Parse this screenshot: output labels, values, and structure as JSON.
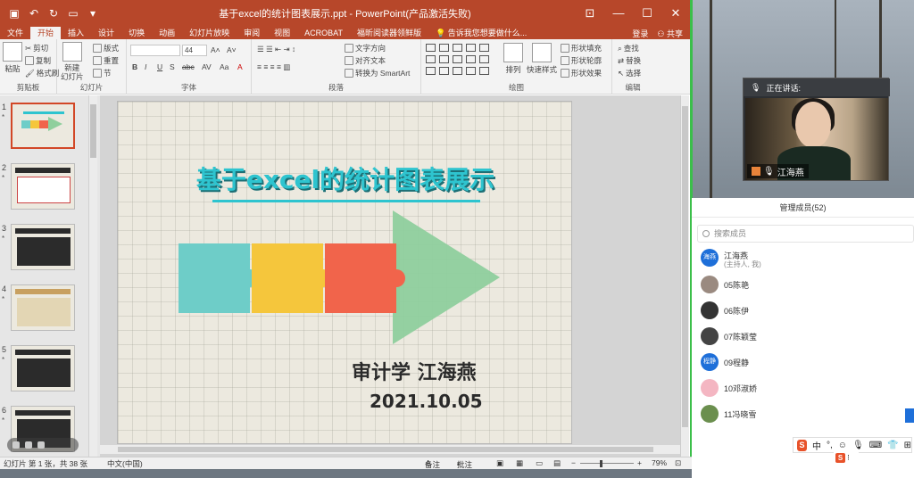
{
  "window": {
    "title": "基于excel的统计图表展示.ppt - PowerPoint(产品激活失败)",
    "login": "登录",
    "share": "共享"
  },
  "tabs": [
    "文件",
    "开始",
    "插入",
    "设计",
    "切换",
    "动画",
    "幻灯片放映",
    "审阅",
    "视图",
    "ACROBAT",
    "福昕阅读器领鲜版"
  ],
  "tell_me": "告诉我您想要做什么...",
  "ribbon": {
    "clipboard": {
      "label": "剪贴板",
      "paste": "粘贴",
      "cut": "剪切",
      "copy": "复制",
      "format_painter": "格式刷"
    },
    "slides": {
      "label": "幻灯片",
      "new_slide": "新建\n幻灯片",
      "layout": "版式",
      "reset": "重置",
      "section": "节"
    },
    "font": {
      "label": "字体",
      "size": "44",
      "bold": "B",
      "italic": "I",
      "underline": "U",
      "strike": "S",
      "abc": "abc"
    },
    "paragraph": {
      "label": "段落",
      "text_direction": "文字方向",
      "align_text": "对齐文本",
      "smartart": "转换为 SmartArt"
    },
    "drawing": {
      "label": "绘图",
      "arrange": "排列",
      "quick_styles": "快速样式",
      "fill": "形状填充",
      "outline": "形状轮廓",
      "effects": "形状效果"
    },
    "editing": {
      "label": "编辑",
      "find": "查找",
      "replace": "替换",
      "select": "选择"
    }
  },
  "thumbnails": [
    {
      "num": "1",
      "star": "*"
    },
    {
      "num": "2",
      "star": "*"
    },
    {
      "num": "3",
      "star": "*"
    },
    {
      "num": "4",
      "star": "*"
    },
    {
      "num": "5",
      "star": "*"
    },
    {
      "num": "6",
      "star": "*"
    }
  ],
  "slide": {
    "title": "基于excel的统计图表展示",
    "author": "审计学  江海燕",
    "date": "2021.10.05",
    "colors": {
      "teal": "#6ecdc8",
      "yellow": "#f5c63c",
      "red": "#f1644b",
      "green": "#8fcf9d"
    }
  },
  "status": {
    "slide_info": "幻灯片 第 1 张，共 38 张",
    "language": "中文(中国)",
    "notes": "备注",
    "comments": "批注",
    "zoom": "79%",
    "minus": "−",
    "plus": "+"
  },
  "meeting": {
    "speaking_label": "正在讲话:",
    "speaker_name": "江海燕",
    "members_title": "管理成员(52)",
    "search_placeholder": "搜索成员",
    "members": [
      {
        "avatar": "海燕",
        "name": "江海燕",
        "sub": "(主持人, 我)",
        "color": "#1e6fd9"
      },
      {
        "avatar": "",
        "name": "05陈艳",
        "sub": "",
        "color": "#9a8a80"
      },
      {
        "avatar": "",
        "name": "06陈伊",
        "sub": "",
        "color": "#333333"
      },
      {
        "avatar": "",
        "name": "07陈颖莹",
        "sub": "",
        "color": "#444444"
      },
      {
        "avatar": "程静",
        "name": "09程静",
        "sub": "",
        "color": "#1e6fd9"
      },
      {
        "avatar": "",
        "name": "10邓淑娇",
        "sub": "",
        "color": "#f4b6c2"
      },
      {
        "avatar": "",
        "name": "11冯晓雪",
        "sub": "",
        "color": "#6b8f4e"
      }
    ]
  },
  "ime": {
    "zh": "中",
    "punct": "°,",
    "logo": "S"
  }
}
